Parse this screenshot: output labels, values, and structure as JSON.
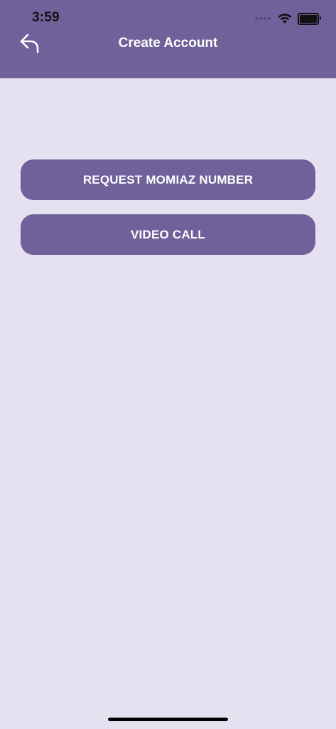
{
  "status_bar": {
    "time": "3:59"
  },
  "header": {
    "title": "Create Account",
    "back_icon": "back-arrow-icon"
  },
  "buttons": {
    "request_label": "REQUEST MOMIAZ NUMBER",
    "video_call_label": "VIDEO CALL"
  },
  "colors": {
    "primary": "#6F6199",
    "background": "#E5E1F0",
    "text_on_primary": "#FFFFFF"
  }
}
